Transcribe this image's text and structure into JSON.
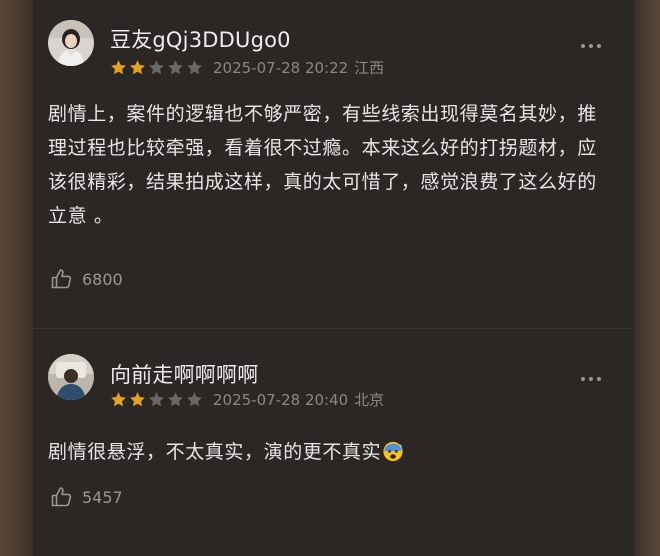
{
  "colors": {
    "page_background": "#2b2725",
    "star_filled": "#e4a21e",
    "star_empty": "#6b6663",
    "text_primary": "#e8e6e4",
    "text_meta": "#8c8784"
  },
  "comments": [
    {
      "username": "豆友gQj3DDUgo0",
      "rating": 2,
      "max_rating": 5,
      "date": "2025-07-28 20:22",
      "location": "江西",
      "text": "剧情上，案件的逻辑也不够严密，有些线索出现得莫名其妙，推理过程也比较牵强，看着很不过瘾。本来这么好的打拐题材，应该很精彩，结果拍成这样，真的太可惜了，感觉浪费了这么好的立意 。",
      "likes": "6800",
      "icons": {
        "avatar": "user-avatar-photo",
        "more": "more-dots-icon",
        "like": "thumbs-up-icon"
      }
    },
    {
      "username": "向前走啊啊啊啊",
      "rating": 2,
      "max_rating": 5,
      "date": "2025-07-28 20:40",
      "location": "北京",
      "text": "剧情很悬浮，不太真实，演的更不真实",
      "emoji": "anxious-face-with-sweat",
      "likes": "5457",
      "icons": {
        "avatar": "user-avatar-photo",
        "more": "more-dots-icon",
        "like": "thumbs-up-icon"
      }
    }
  ]
}
